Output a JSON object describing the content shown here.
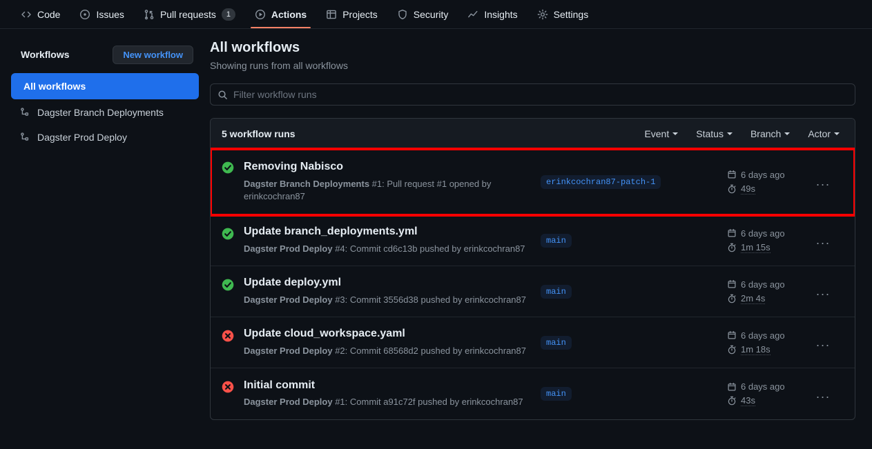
{
  "repo_nav": {
    "items": [
      {
        "label": "Code",
        "icon": "code-icon",
        "active": false,
        "counter": null
      },
      {
        "label": "Issues",
        "icon": "issue-icon",
        "active": false,
        "counter": null
      },
      {
        "label": "Pull requests",
        "icon": "git-pull-request-icon",
        "active": false,
        "counter": "1"
      },
      {
        "label": "Actions",
        "icon": "play-icon",
        "active": true,
        "counter": null
      },
      {
        "label": "Projects",
        "icon": "table-icon",
        "active": false,
        "counter": null
      },
      {
        "label": "Security",
        "icon": "shield-icon",
        "active": false,
        "counter": null
      },
      {
        "label": "Insights",
        "icon": "graph-icon",
        "active": false,
        "counter": null
      },
      {
        "label": "Settings",
        "icon": "gear-icon",
        "active": false,
        "counter": null
      }
    ]
  },
  "sidebar": {
    "title": "Workflows",
    "new_workflow_label": "New workflow",
    "items": [
      {
        "label": "All workflows",
        "selected": true,
        "icon": null
      },
      {
        "label": "Dagster Branch Deployments",
        "selected": false,
        "icon": "workflow-icon"
      },
      {
        "label": "Dagster Prod Deploy",
        "selected": false,
        "icon": "workflow-icon"
      }
    ]
  },
  "main": {
    "title": "All workflows",
    "subtitle": "Showing runs from all workflows",
    "search": {
      "placeholder": "Filter workflow runs",
      "value": "",
      "icon": "search-icon"
    },
    "runs_count_label": "5 workflow runs",
    "filters": [
      {
        "label": "Event"
      },
      {
        "label": "Status"
      },
      {
        "label": "Branch"
      },
      {
        "label": "Actor"
      }
    ],
    "runs": [
      {
        "title": "Removing Nabisco",
        "status": "success",
        "workflow_name": "Dagster Branch Deployments",
        "detail": " #1: Pull request #1 opened by erinkcochran87",
        "branch": "erinkcochran87-patch-1",
        "time_ago": "6 days ago",
        "duration": "49s",
        "highlighted": true,
        "kebab": "..."
      },
      {
        "title": "Update branch_deployments.yml",
        "status": "success",
        "workflow_name": "Dagster Prod Deploy",
        "detail": " #4: Commit cd6c13b pushed by erinkcochran87",
        "branch": "main",
        "time_ago": "6 days ago",
        "duration": "1m 15s",
        "highlighted": false,
        "kebab": "..."
      },
      {
        "title": "Update deploy.yml",
        "status": "success",
        "workflow_name": "Dagster Prod Deploy",
        "detail": " #3: Commit 3556d38 pushed by erinkcochran87",
        "branch": "main",
        "time_ago": "6 days ago",
        "duration": "2m 4s",
        "highlighted": false,
        "kebab": "..."
      },
      {
        "title": "Update cloud_workspace.yaml",
        "status": "failure",
        "workflow_name": "Dagster Prod Deploy",
        "detail": " #2: Commit 68568d2 pushed by erinkcochran87",
        "branch": "main",
        "time_ago": "6 days ago",
        "duration": "1m 18s",
        "highlighted": false,
        "kebab": "..."
      },
      {
        "title": "Initial commit",
        "status": "failure",
        "workflow_name": "Dagster Prod Deploy",
        "detail": " #1: Commit a91c72f pushed by erinkcochran87",
        "branch": "main",
        "time_ago": "6 days ago",
        "duration": "43s",
        "highlighted": false,
        "kebab": "..."
      }
    ]
  },
  "colors": {
    "page_bg": "#0d1117",
    "border": "#30363d",
    "accent_blue": "#1f6feb",
    "link_blue": "#4493f8",
    "active_tab_underline": "#f78166",
    "success_green": "#3fb950",
    "failure_red": "#f85149",
    "highlight_red": "#ff0000",
    "muted_text": "#8b949e"
  }
}
